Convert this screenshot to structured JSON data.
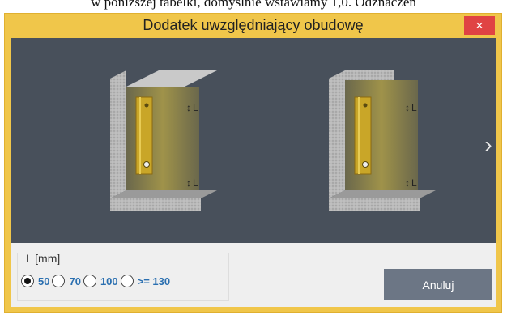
{
  "background_text": "w poniższej tabelki, domyślnie wstawiamy 1,0. Odznaczen",
  "dialog": {
    "title": "Dodatek uwzględniający obudowę",
    "close_glyph": "×",
    "next_glyph": "›",
    "images": [
      {
        "name": "radiator-in-niche-open-top",
        "dim_label_top": "L",
        "dim_label_bottom": "L"
      },
      {
        "name": "radiator-in-niche-covered-top",
        "dim_label_top": "L",
        "dim_label_bottom": "L"
      }
    ],
    "group_label": "L [mm]",
    "options": [
      {
        "label": "50",
        "checked": true
      },
      {
        "label": "70",
        "checked": false
      },
      {
        "label": "100",
        "checked": false
      },
      {
        "label": ">= 130",
        "checked": false
      }
    ],
    "cancel_label": "Anuluj"
  },
  "colors": {
    "accent": "#f0c64a",
    "panel": "#48505b",
    "close": "#e04343",
    "button": "#6c7685",
    "option_text": "#2a6fb0"
  }
}
